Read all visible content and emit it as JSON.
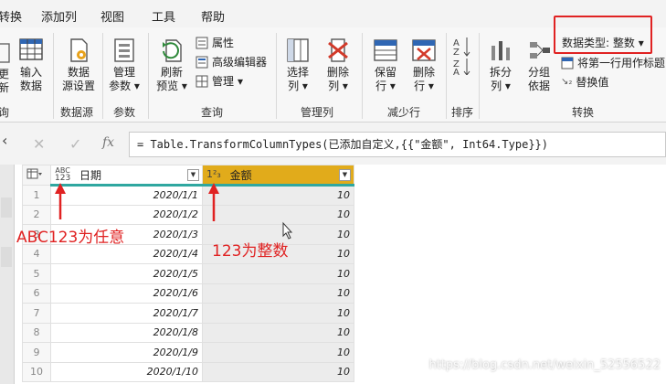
{
  "menu": {
    "items": [
      "转换",
      "添加列",
      "视图",
      "工具",
      "帮助"
    ]
  },
  "ribbon": {
    "left_partial_1": "更",
    "left_partial_2": "新",
    "input_data": [
      "输入",
      "数据"
    ],
    "data_source_settings": [
      "数据",
      "源设置"
    ],
    "manage_params": [
      "管理",
      "参数"
    ],
    "refresh_preview": [
      "刷新",
      "预览"
    ],
    "properties": "属性",
    "advanced_editor": "高级编辑器",
    "manage": "管理",
    "choose_columns": [
      "选择",
      "列"
    ],
    "remove_columns": [
      "删除",
      "列"
    ],
    "keep_rows": [
      "保留",
      "行"
    ],
    "remove_rows": [
      "删除",
      "行"
    ],
    "split_column": [
      "拆分",
      "列"
    ],
    "group_by": [
      "分组",
      "依据"
    ],
    "data_type_label": "数据类型: 整数",
    "first_row_header": "将第一行用作标题",
    "replace_values": "替换值",
    "groups": {
      "query_partial": "询",
      "data_source": "数据源",
      "params": "参数",
      "query": "查询",
      "manage_columns": "管理列",
      "reduce_rows": "减少行",
      "sort": "排序",
      "transform": "转换"
    }
  },
  "formula": {
    "text": "= Table.TransformColumnTypes(已添加自定义,{{\"金额\", Int64.Type}})"
  },
  "table": {
    "col_date": "日期",
    "col_amount": "金额",
    "date_type_top": "ABC",
    "date_type_bottom": "123",
    "amount_type": "1²₃",
    "rows": [
      {
        "n": "1",
        "date": "2020/1/1",
        "amt": "10"
      },
      {
        "n": "2",
        "date": "2020/1/2",
        "amt": "10"
      },
      {
        "n": "3",
        "date": "2020/1/3",
        "amt": "10"
      },
      {
        "n": "4",
        "date": "2020/1/4",
        "amt": "10"
      },
      {
        "n": "5",
        "date": "2020/1/5",
        "amt": "10"
      },
      {
        "n": "6",
        "date": "2020/1/6",
        "amt": "10"
      },
      {
        "n": "7",
        "date": "2020/1/7",
        "amt": "10"
      },
      {
        "n": "8",
        "date": "2020/1/8",
        "amt": "10"
      },
      {
        "n": "9",
        "date": "2020/1/9",
        "amt": "10"
      },
      {
        "n": "10",
        "date": "2020/1/10",
        "amt": "10"
      }
    ]
  },
  "annotations": {
    "abc123": "ABC123为任意",
    "int123": "123为整数"
  },
  "watermark": "https://blog.csdn.net/weixin_52556522",
  "colors": {
    "accent_red": "#e02222",
    "amount_header": "#e1ab1b",
    "header_underline": "#2fa7a0"
  }
}
